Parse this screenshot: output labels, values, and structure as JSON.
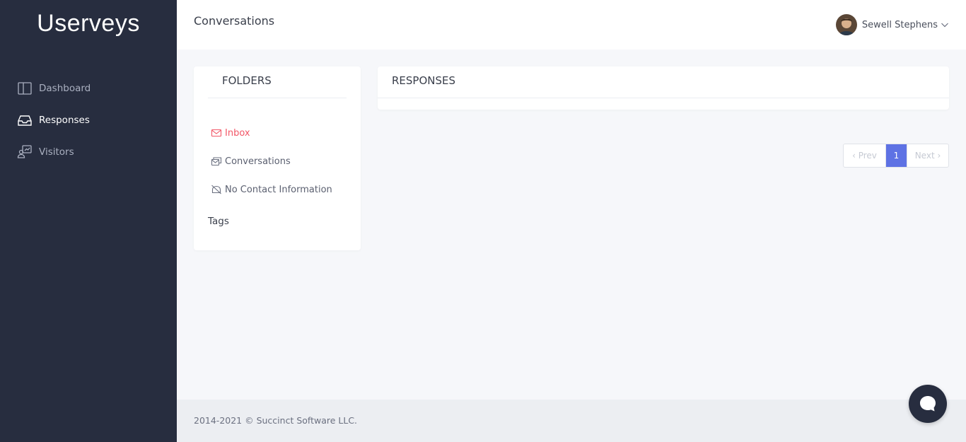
{
  "sidebar": {
    "logo": "Userveys",
    "items": [
      {
        "label": "Dashboard",
        "icon": "columns-icon"
      },
      {
        "label": "Responses",
        "icon": "inbox-icon"
      },
      {
        "label": "Visitors",
        "icon": "visitors-icon"
      }
    ]
  },
  "header": {
    "title": "Conversations",
    "user_name": "Sewell Stephens"
  },
  "folders": {
    "title": "FOLDERS",
    "items": [
      {
        "label": "Inbox",
        "icon": "envelope-icon"
      },
      {
        "label": "Conversations",
        "icon": "conversations-icon"
      },
      {
        "label": "No Contact Information",
        "icon": "no-contact-icon"
      }
    ],
    "tags_label": "Tags"
  },
  "responses": {
    "title": "RESPONSES"
  },
  "pagination": {
    "prev": "‹ Prev",
    "current": "1",
    "next": "Next ›"
  },
  "footer": {
    "copyright": "2014-2021 © Succinct Software LLC."
  },
  "colors": {
    "sidebar_bg": "#272d3f",
    "accent": "#5e72e4",
    "active_folder": "#f25767"
  }
}
